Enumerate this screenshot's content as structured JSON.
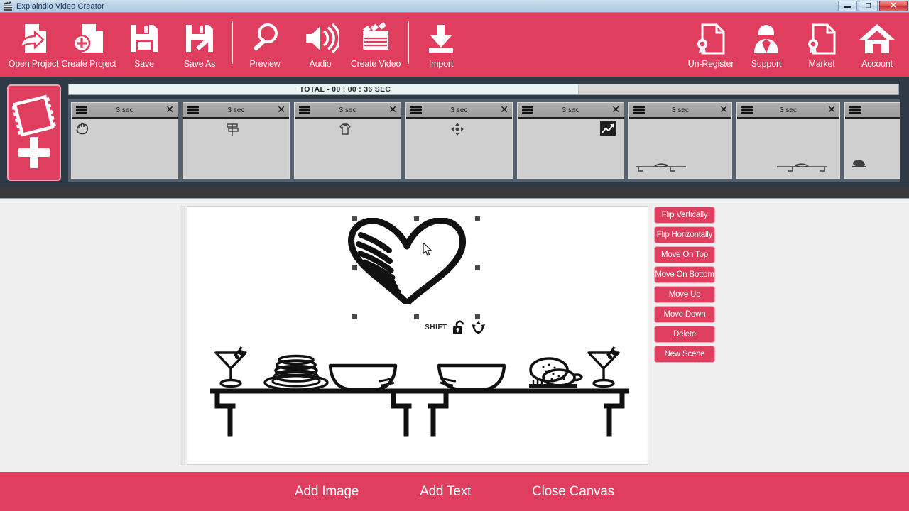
{
  "window": {
    "title": "Explaindio Video Creator",
    "icon": "clapperboard-icon",
    "minimize_label": "▬",
    "maximize_label": "❐",
    "close_label": "✕"
  },
  "colors": {
    "brand_pink": "#e03e5e",
    "brand_pink_border": "#f0a5b5",
    "titlebar_blue": "#bcd3e6",
    "timeline_dark": "#2e3a46",
    "strip_gray": "#55616c",
    "workspace_gray": "#efefef",
    "canvas_white": "#ffffff",
    "divider_dark": "#3a3a3a"
  },
  "toolbar": {
    "left_items": [
      {
        "label": "Open Project",
        "icon": "open-project-icon"
      },
      {
        "label": "Create Project",
        "icon": "create-project-icon"
      },
      {
        "label": "Save",
        "icon": "save-icon"
      },
      {
        "label": "Save As",
        "icon": "save-as-icon"
      },
      {
        "label": "Preview",
        "icon": "magnifier-preview-icon"
      },
      {
        "label": "Audio",
        "icon": "speaker-audio-icon"
      },
      {
        "label": "Create Video",
        "icon": "clapperboard-video-icon"
      },
      {
        "label": "Import",
        "icon": "import-download-icon"
      }
    ],
    "right_items": [
      {
        "label": "Un-Register",
        "icon": "certificate-document-icon"
      },
      {
        "label": "Support",
        "icon": "person-support-icon"
      },
      {
        "label": "Market",
        "icon": "certificate-market-icon"
      },
      {
        "label": "Account",
        "icon": "home-account-icon"
      }
    ]
  },
  "timeline": {
    "add_scene_icon": "filmstrip-plus-icon",
    "total_label": "TOTAL - 00 : 00 : 36 SEC",
    "progress_percent": 61.5,
    "scenes": [
      {
        "duration": "3 sec",
        "close_label": "✕",
        "layers_icon": "layers-icon",
        "thumb": "hand-sketch"
      },
      {
        "duration": "3 sec",
        "close_label": "✕",
        "layers_icon": "layers-icon",
        "thumb": "signpost-sketch"
      },
      {
        "duration": "3 sec",
        "close_label": "✕",
        "layers_icon": "layers-icon",
        "thumb": "shirt-sketch"
      },
      {
        "duration": "3 sec",
        "close_label": "✕",
        "layers_icon": "layers-icon",
        "thumb": "arrows-sketch"
      },
      {
        "duration": "3 sec",
        "close_label": "✕",
        "layers_icon": "layers-icon",
        "thumb": "chart-image-icon"
      },
      {
        "duration": "3 sec",
        "close_label": "✕",
        "layers_icon": "layers-icon",
        "thumb": "table-bowl-sketch"
      },
      {
        "duration": "3 sec",
        "close_label": "✕",
        "layers_icon": "layers-icon",
        "thumb": "table-bowl-sketch-mirror"
      },
      {
        "duration": "",
        "close_label": "",
        "layers_icon": "layers-icon",
        "thumb": "turkey-sketch"
      }
    ]
  },
  "canvas": {
    "selected_object": "heart-sketch",
    "shift_label": "SHIFT",
    "lock_icon": "padlock-open-icon",
    "rotate_icon": "rotate-arrows-icon",
    "cursor_icon": "mouse-pointer-icon",
    "scene_objects": [
      "martini-glass-left",
      "pancake-stack-plate",
      "bowl-left",
      "bowl-right",
      "roast-turkey-board",
      "martini-glass-right",
      "table-left",
      "table-right"
    ]
  },
  "actions": {
    "buttons": [
      "Flip Vertically",
      "Flip Horizontally",
      "Move On Top",
      "Move On Bottom",
      "Move Up",
      "Move Down",
      "Delete",
      "New Scene"
    ]
  },
  "bottom_bar": {
    "items": [
      "Add Image",
      "Add Text",
      "Close Canvas"
    ]
  }
}
